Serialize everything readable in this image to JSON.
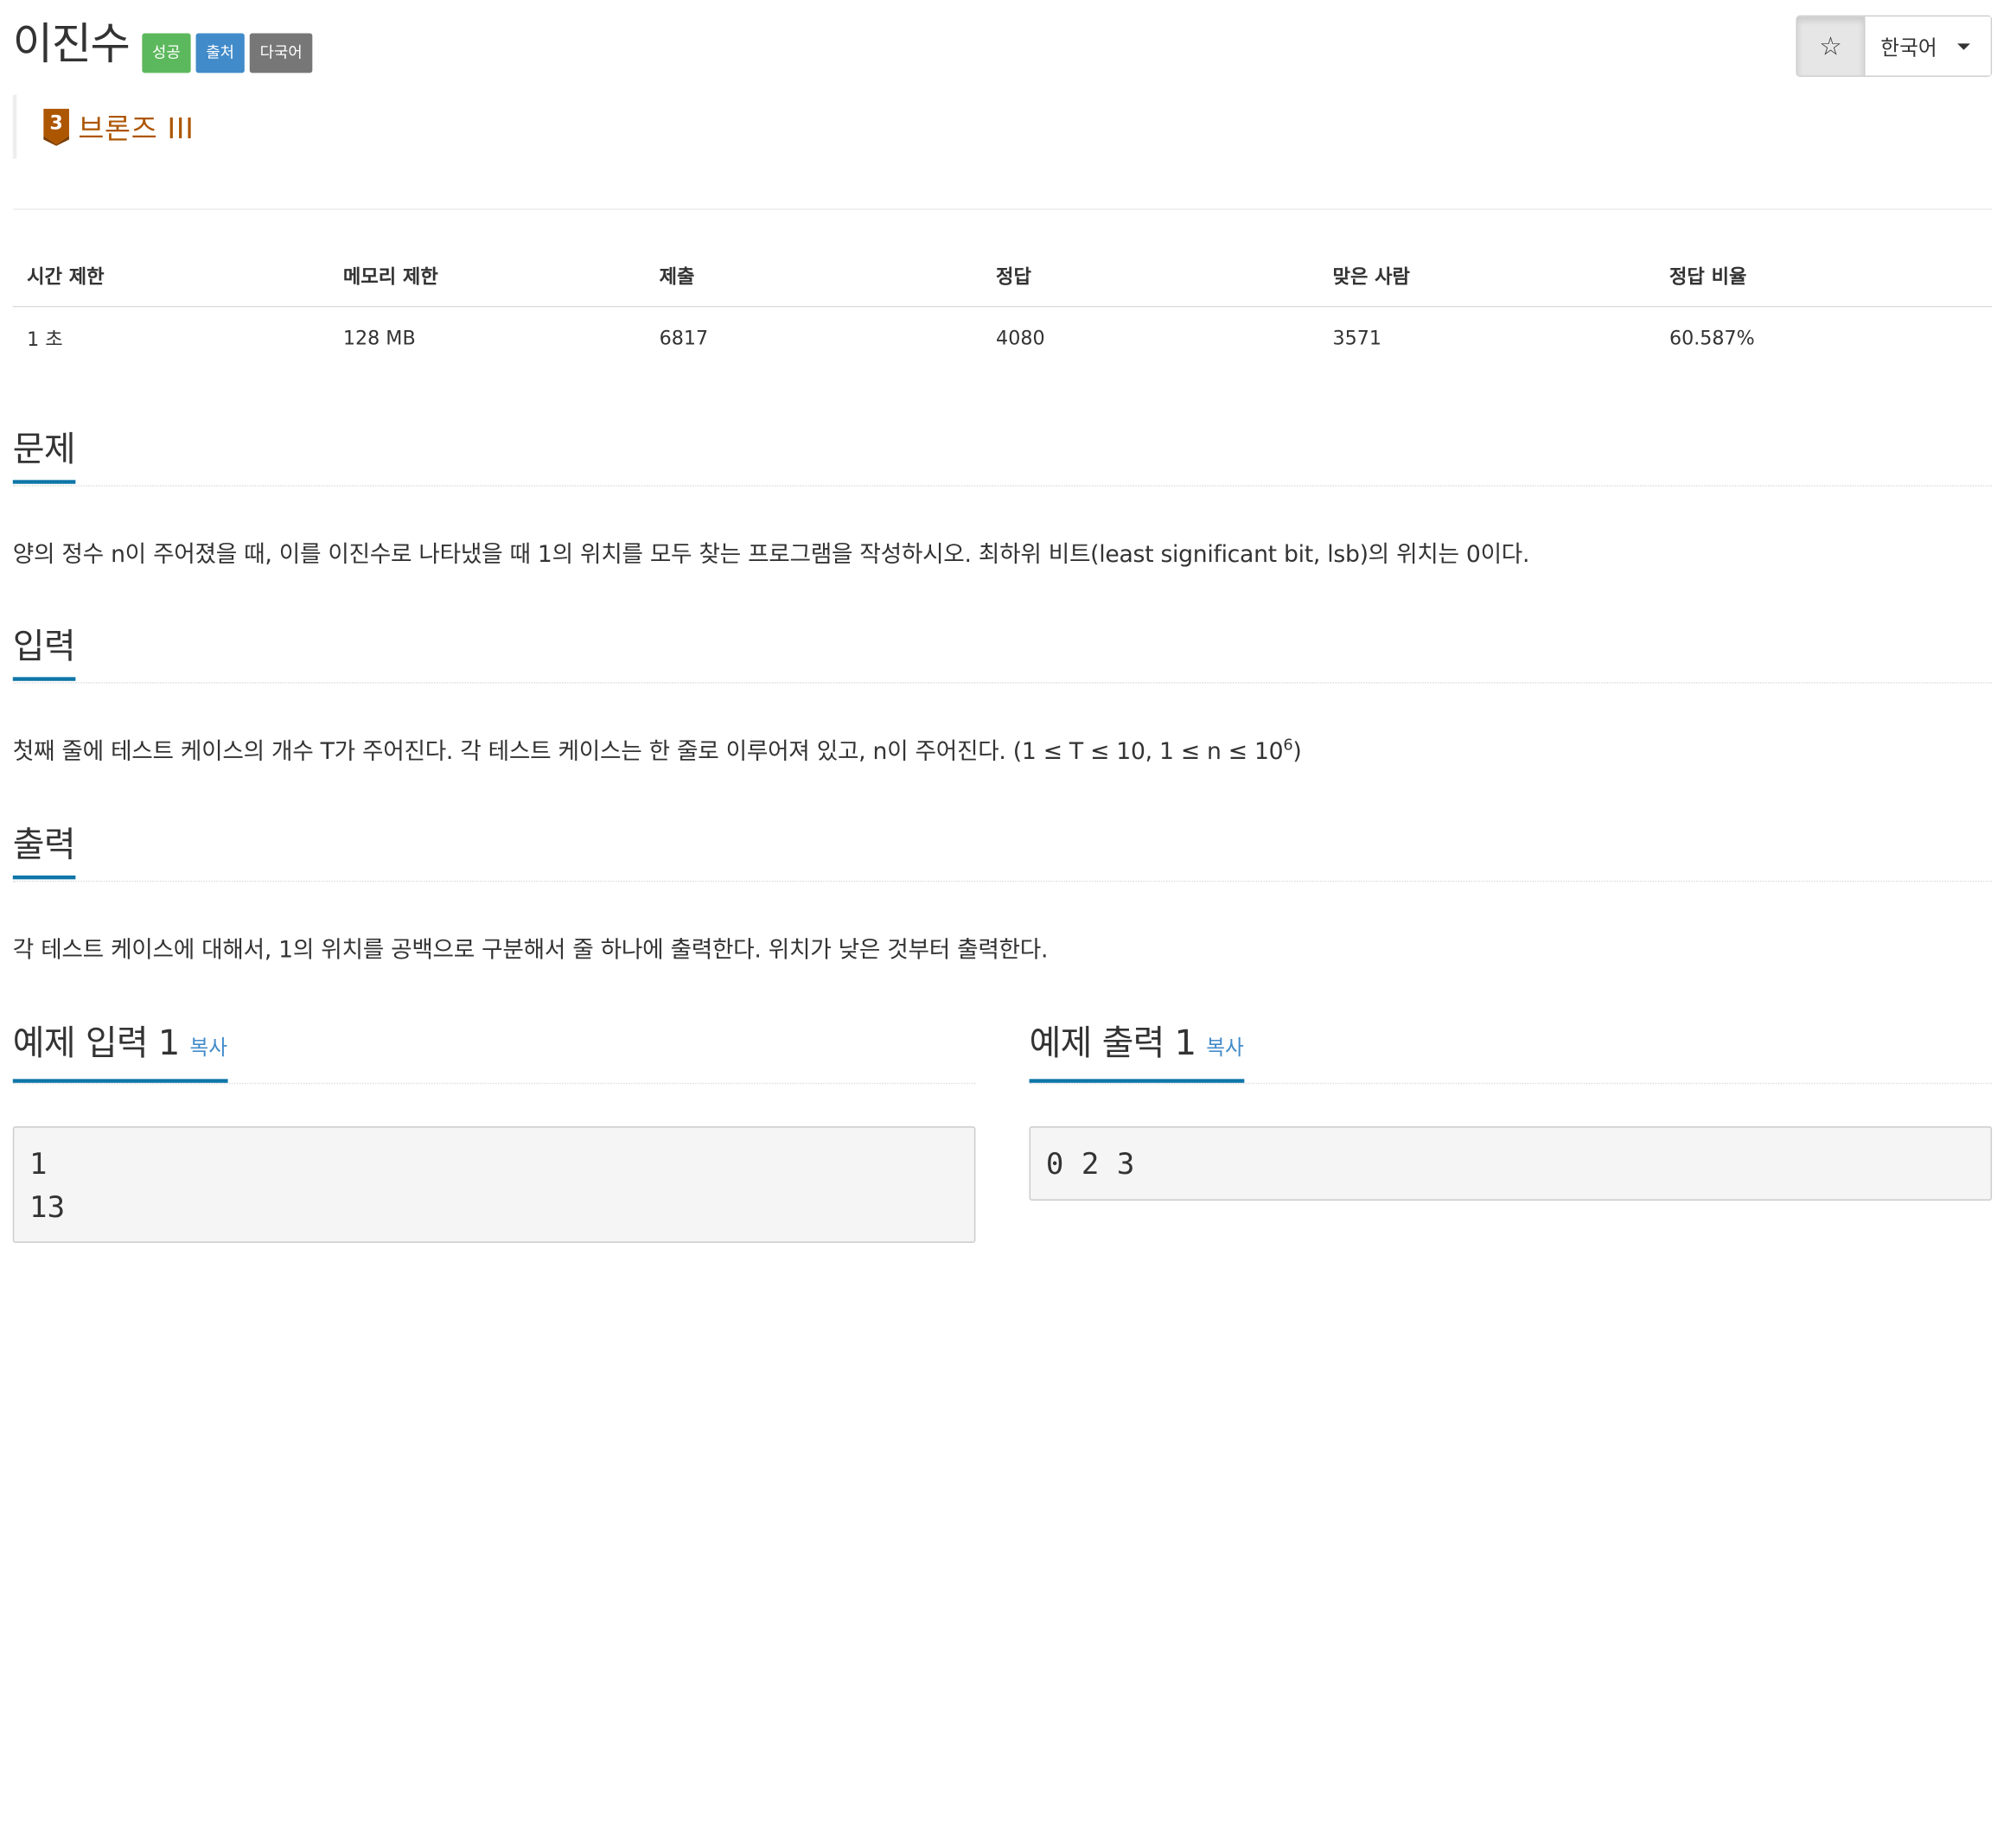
{
  "problem": {
    "title": "이진수",
    "labels": {
      "success": "성공",
      "source": "출처",
      "multilang": "다국어"
    },
    "tier": "브론즈 III",
    "tier_level": "3",
    "tier_color": "#ad5600"
  },
  "toolbar": {
    "star_icon": "☆",
    "language": "한국어"
  },
  "stats": {
    "headers": [
      "시간 제한",
      "메모리 제한",
      "제출",
      "정답",
      "맞은 사람",
      "정답 비율"
    ],
    "values": [
      "1 초",
      "128 MB",
      "6817",
      "4080",
      "3571",
      "60.587%"
    ]
  },
  "sections": {
    "description": {
      "title": "문제",
      "body": "양의 정수 n이 주어졌을 때, 이를 이진수로 나타냈을 때 1의 위치를 모두 찾는 프로그램을 작성하시오. 최하위 비트(least significant bit, lsb)의 위치는 0이다."
    },
    "input": {
      "title": "입력",
      "body": "첫째 줄에 테스트 케이스의 개수 T가 주어진다. 각 테스트 케이스는 한 줄로 이루어져 있고, n이 주어진다. (1 ≤ T ≤ 10, 1 ≤ n ≤ 10",
      "body_sup": "6",
      "body_end": ")"
    },
    "output": {
      "title": "출력",
      "body": "각 테스트 케이스에 대해서, 1의 위치를 공백으로 구분해서 줄 하나에 출력한다. 위치가 낮은 것부터 출력한다."
    }
  },
  "samples": {
    "input": {
      "title": "예제 입력 1",
      "copy": "복사",
      "content": "1\n13"
    },
    "output": {
      "title": "예제 출력 1",
      "copy": "복사",
      "content": "0 2 3"
    }
  },
  "colors": {
    "success": "#5cb85c",
    "source": "#428bca",
    "multilang": "#777777",
    "section_underline": "#0e76a8",
    "link": "#428bca"
  }
}
